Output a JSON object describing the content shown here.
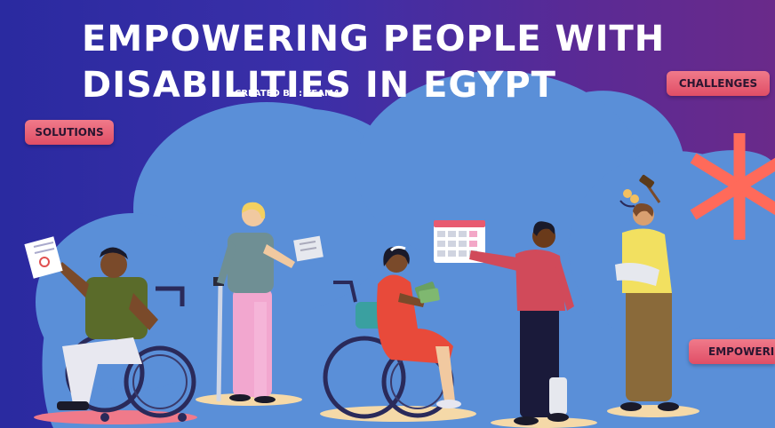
{
  "hero": {
    "title": "EMPOWERING PEOPLE WITH DISABILITIES IN EGYPT",
    "credit": "CREATED BY : TEAM4"
  },
  "nav": {
    "solutions": "SOLUTIONS",
    "challenges": "CHALLENGES",
    "empowering": "EMPOWERING"
  },
  "colors": {
    "background_start": "#2a2aa0",
    "background_end": "#6a2a8a",
    "cloud": "#5a8fd8",
    "pill": "#e85a70",
    "asterisk": "#ff6a5a",
    "title_text": "#ffffff"
  },
  "illustration": {
    "people": [
      "man-in-wheelchair-holding-document",
      "woman-with-crutch-holding-paper",
      "woman-in-wheelchair-holding-money",
      "man-pointing-at-calendar",
      "man-with-arm-sling"
    ],
    "icons": [
      "document-icon",
      "calendar-icon",
      "gavel-icon",
      "coins-icon",
      "asterisk-icon"
    ]
  }
}
